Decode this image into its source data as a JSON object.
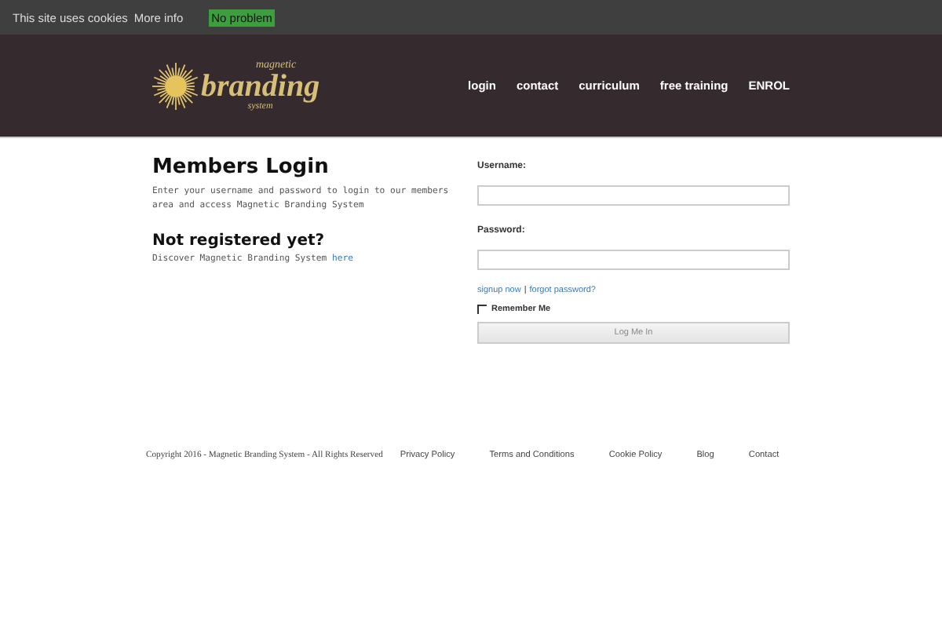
{
  "cookie_bar": {
    "message": "This site uses cookies",
    "more_info": "More info",
    "accept": "No problem"
  },
  "logo": {
    "top": "magnetic",
    "main": "branding",
    "bottom": "system"
  },
  "nav": [
    {
      "label": "login"
    },
    {
      "label": "contact"
    },
    {
      "label": "curriculum"
    },
    {
      "label": "free training"
    },
    {
      "label": "ENROL"
    }
  ],
  "intro": {
    "title": "Members Login",
    "text": "Enter your username and password to login to our members area and access Magnetic Branding System",
    "subtitle": "Not registered yet?",
    "discover": "Discover Magnetic Branding System",
    "link": "here"
  },
  "form": {
    "username_label": "Username:",
    "password_label": "Password:",
    "signup": "signup now",
    "separator": "|",
    "forgot": "forgot password?",
    "remember": {
      "label": "Remember Me",
      "checked": false
    },
    "submit": "Log Me In"
  },
  "footer": {
    "copyright": "Copyright 2016 - Magnetic Branding System - All Rights Reserved",
    "links": [
      {
        "label": "Privacy Policy"
      },
      {
        "label": "Terms and Conditions"
      },
      {
        "label": "Cookie Policy"
      },
      {
        "label": "Blog"
      },
      {
        "label": "Contact"
      }
    ]
  }
}
